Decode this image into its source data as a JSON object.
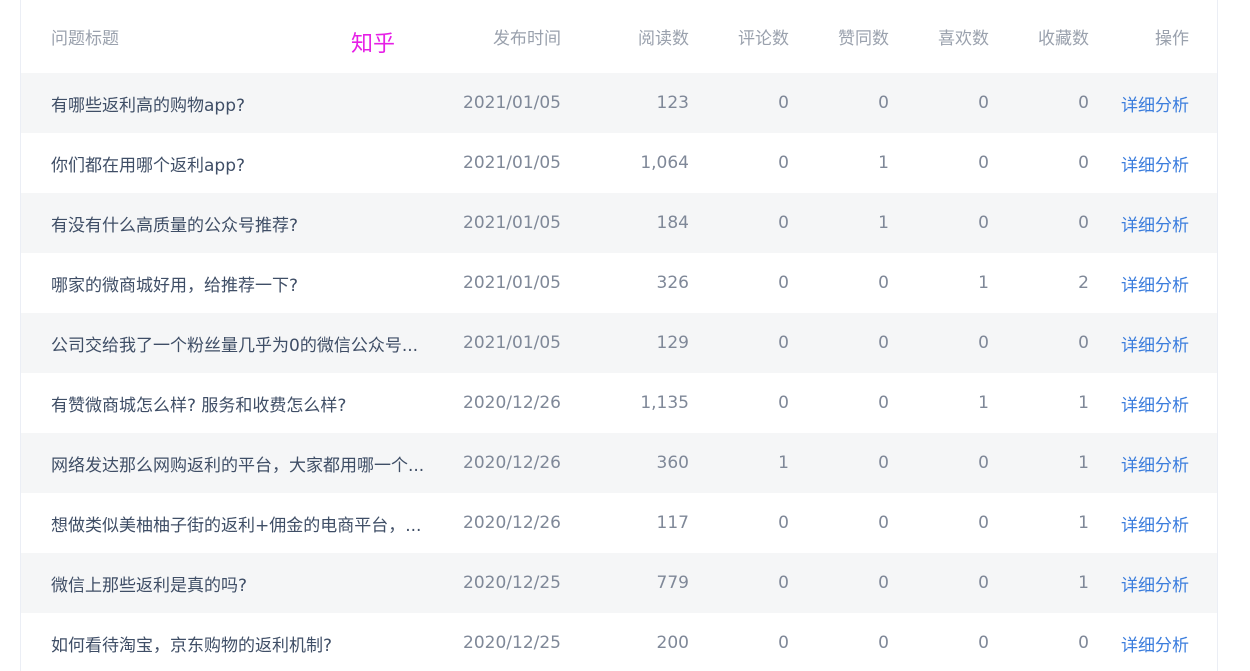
{
  "platform": "知乎",
  "columns": {
    "title": "问题标题",
    "date": "发布时间",
    "reads": "阅读数",
    "comments": "评论数",
    "likes": "赞同数",
    "favorites": "喜欢数",
    "collects": "收藏数",
    "action": "操作"
  },
  "rows": [
    {
      "title": "有哪些返利高的购物app?",
      "date": "2021/01/05",
      "reads": "123",
      "comments": "0",
      "likes": "0",
      "favorites": "0",
      "collects": "0",
      "action": "详细分析"
    },
    {
      "title": "你们都在用哪个返利app?",
      "date": "2021/01/05",
      "reads": "1,064",
      "comments": "0",
      "likes": "1",
      "favorites": "0",
      "collects": "0",
      "action": "详细分析"
    },
    {
      "title": "有没有什么高质量的公众号推荐?",
      "date": "2021/01/05",
      "reads": "184",
      "comments": "0",
      "likes": "1",
      "favorites": "0",
      "collects": "0",
      "action": "详细分析"
    },
    {
      "title": "哪家的微商城好用，给推荐一下?",
      "date": "2021/01/05",
      "reads": "326",
      "comments": "0",
      "likes": "0",
      "favorites": "1",
      "collects": "2",
      "action": "详细分析"
    },
    {
      "title": "公司交给我了一个粉丝量几乎为0的微信公众号...",
      "date": "2021/01/05",
      "reads": "129",
      "comments": "0",
      "likes": "0",
      "favorites": "0",
      "collects": "0",
      "action": "详细分析"
    },
    {
      "title": "有赞微商城怎么样? 服务和收费怎么样?",
      "date": "2020/12/26",
      "reads": "1,135",
      "comments": "0",
      "likes": "0",
      "favorites": "1",
      "collects": "1",
      "action": "详细分析"
    },
    {
      "title": "网络发达那么网购返利的平台，大家都用哪一个...",
      "date": "2020/12/26",
      "reads": "360",
      "comments": "1",
      "likes": "0",
      "favorites": "0",
      "collects": "1",
      "action": "详细分析"
    },
    {
      "title": "想做类似美柚柚子街的返利+佣金的电商平台，...",
      "date": "2020/12/26",
      "reads": "117",
      "comments": "0",
      "likes": "0",
      "favorites": "0",
      "collects": "1",
      "action": "详细分析"
    },
    {
      "title": "微信上那些返利是真的吗?",
      "date": "2020/12/25",
      "reads": "779",
      "comments": "0",
      "likes": "0",
      "favorites": "0",
      "collects": "1",
      "action": "详细分析"
    },
    {
      "title": "如何看待淘宝，京东购物的返利机制?",
      "date": "2020/12/25",
      "reads": "200",
      "comments": "0",
      "likes": "0",
      "favorites": "0",
      "collects": "0",
      "action": "详细分析"
    }
  ]
}
